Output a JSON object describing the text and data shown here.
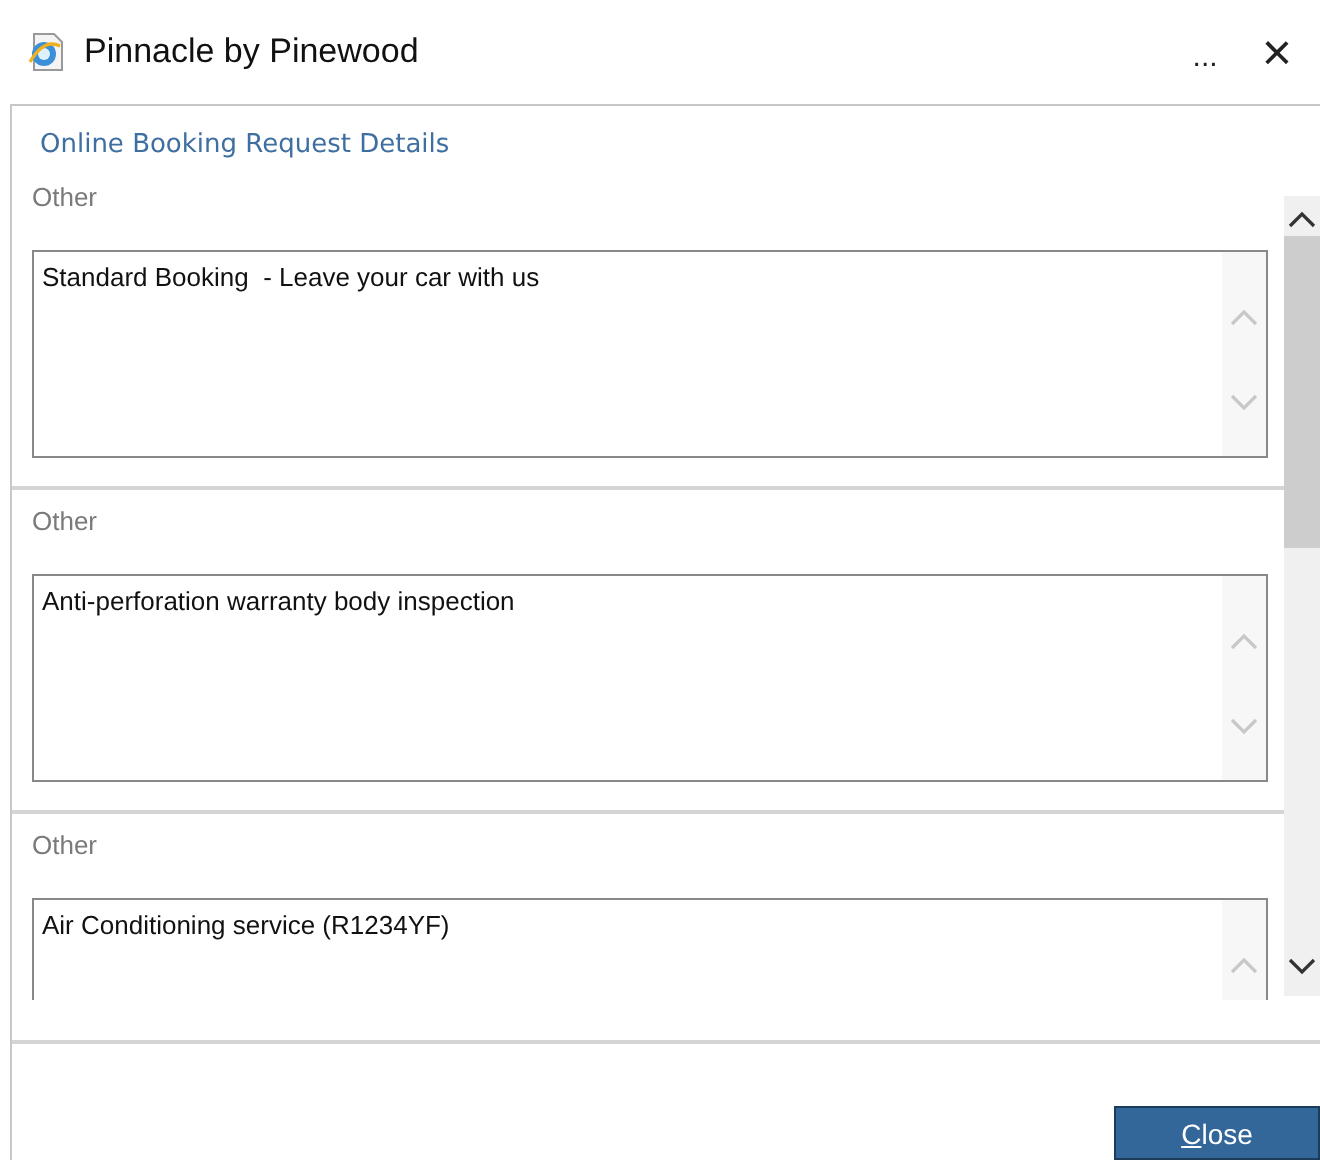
{
  "window": {
    "title": "Pinnacle by Pinewood",
    "more": "...",
    "close": "×"
  },
  "heading": "Online Booking Request Details",
  "sections": [
    {
      "label": "Other",
      "value": "Standard Booking  - Leave your car with us"
    },
    {
      "label": "Other",
      "value": "Anti-perforation warranty body inspection"
    },
    {
      "label": "Other",
      "value": "Air Conditioning service (R1234YF)"
    }
  ],
  "buttons": [
    "Close"
  ]
}
